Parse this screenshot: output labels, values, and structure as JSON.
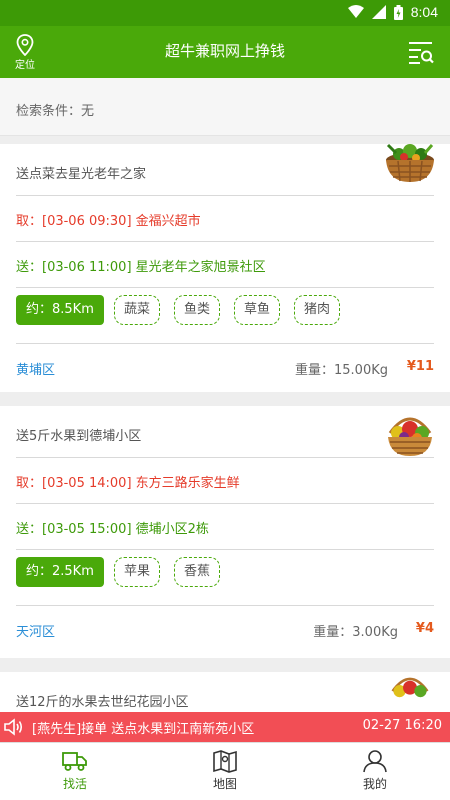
{
  "status_bar": {
    "time": "8:04"
  },
  "header": {
    "location_label": "定位",
    "title": "超牛兼职网上挣钱"
  },
  "filter": {
    "condition": "检索条件：无"
  },
  "orders": [
    {
      "title": "送点菜去星光老年之家",
      "pickup": "取：[03-06 09:30] 金福兴超市",
      "dropoff": "送：[03-06 11:00] 星光老年之家旭景社区",
      "distance": "约：8.5Km",
      "tags": [
        "蔬菜",
        "鱼类",
        "草鱼",
        "猪肉"
      ],
      "district": "黄埔区",
      "weight": "重量：15.00Kg",
      "price": "¥11"
    },
    {
      "title": "送5斤水果到德埔小区",
      "pickup": "取：[03-05 14:00] 东方三路乐家生鲜",
      "dropoff": "送：[03-05 15:00] 德埔小区2栋",
      "distance": "约：2.5Km",
      "tags": [
        "苹果",
        "香蕉"
      ],
      "district": "天河区",
      "weight": "重量：3.00Kg",
      "price": "¥4"
    },
    {
      "title": "送12斤的水果去世纪花园小区"
    }
  ],
  "ticker": {
    "message": "[燕先生]接单 送点水果到江南新苑小区",
    "time": "02-27 16:20"
  },
  "tabs": [
    {
      "label": "找活",
      "icon": "truck-icon",
      "active": true
    },
    {
      "label": "地图",
      "icon": "map-icon",
      "active": false
    },
    {
      "label": "我的",
      "icon": "user-icon",
      "active": false
    }
  ],
  "colors": {
    "primary_green": "#4aa90a",
    "pickup_red": "#e53b2a",
    "dropoff_green": "#3e9a0a",
    "district_blue": "#2b8ed6",
    "price_orange": "#e45a1e",
    "ticker_red": "#f24e55"
  }
}
